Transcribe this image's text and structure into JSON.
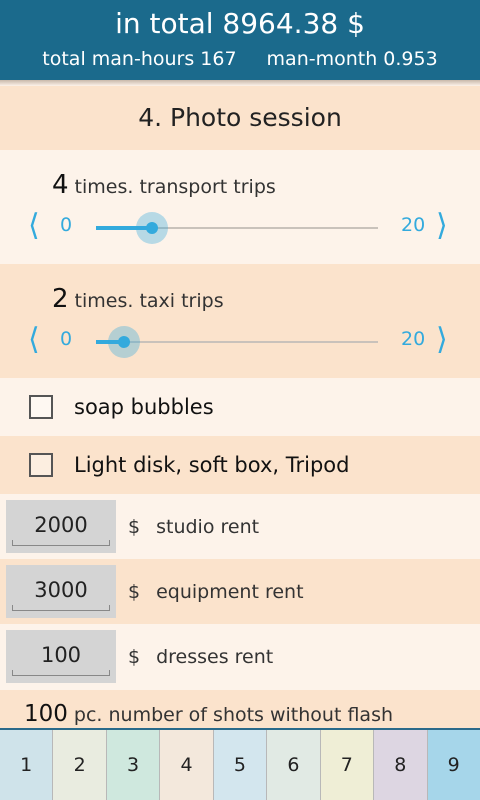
{
  "header": {
    "total_text": "in total 8964.38 $",
    "man_hours_text": "total man-hours 167",
    "man_month_text": "man-month 0.953"
  },
  "section": {
    "title": "4. Photo session"
  },
  "sliders": [
    {
      "count": "4",
      "label": "times.  transport trips",
      "min": "0",
      "max": "20",
      "value": 4
    },
    {
      "count": "2",
      "label": "times.  taxi trips",
      "min": "0",
      "max": "20",
      "value": 2
    }
  ],
  "arrows": {
    "left": "⟨",
    "right": "⟩"
  },
  "checkboxes": [
    {
      "label": "soap bubbles",
      "checked": false
    },
    {
      "label": "Light disk, soft box, Tripod",
      "checked": false
    }
  ],
  "inputs": [
    {
      "value": "2000",
      "currency": "$",
      "label": "studio rent"
    },
    {
      "value": "3000",
      "currency": "$",
      "label": "equipment rent"
    },
    {
      "value": "100",
      "currency": "$",
      "label": "dresses rent"
    }
  ],
  "shots": {
    "count": "100",
    "label": "pc.  number of shots without flash"
  },
  "tabs": [
    {
      "label": "1",
      "color": "#cfe3ea"
    },
    {
      "label": "2",
      "color": "#e9ece0"
    },
    {
      "label": "3",
      "color": "#cfe8de"
    },
    {
      "label": "4",
      "color": "#f3e8dc"
    },
    {
      "label": "5",
      "color": "#d3e6ee"
    },
    {
      "label": "6",
      "color": "#e1eae4"
    },
    {
      "label": "7",
      "color": "#efeed6"
    },
    {
      "label": "8",
      "color": "#ddd6e2"
    },
    {
      "label": "9",
      "color": "#a6d6ea"
    }
  ],
  "colors": {
    "header_bg": "#1b6a8c",
    "accent": "#33aadd",
    "row_dark": "#fbe3cc",
    "row_light": "#fdf3ea"
  }
}
